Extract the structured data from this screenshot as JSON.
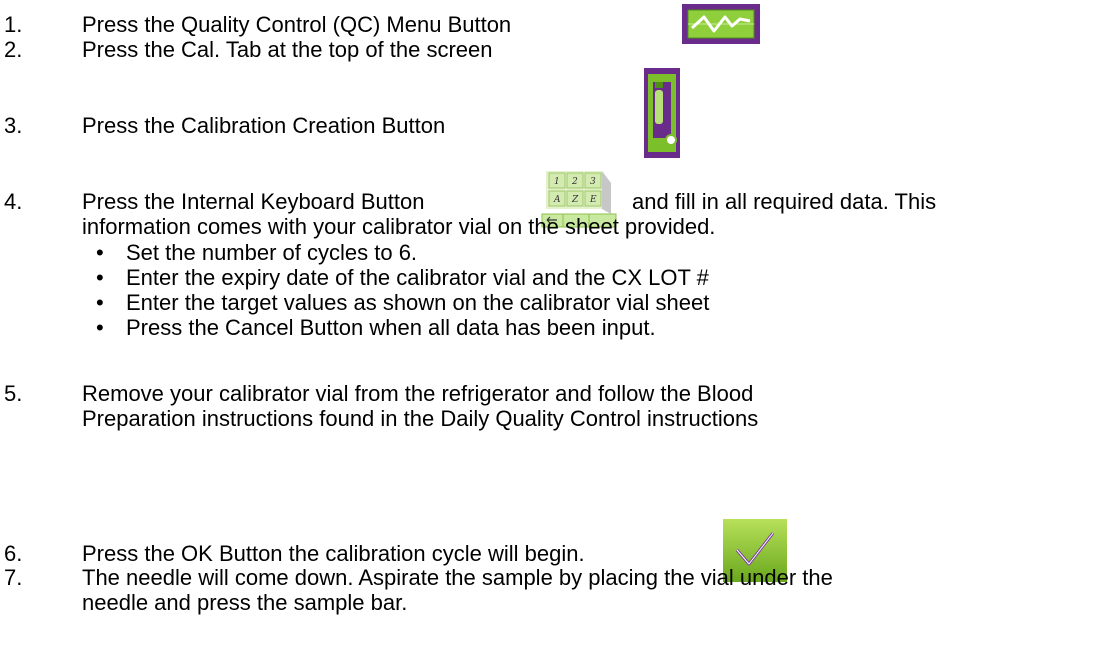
{
  "steps": [
    {
      "number": "1.",
      "text": "Press the Quality Control (QC) Menu Button"
    },
    {
      "number": "2.",
      "text": "Press the Cal. Tab at the top of the screen"
    },
    {
      "number": "3.",
      "text": "Press the Calibration Creation Button"
    },
    {
      "number": "4.",
      "text": "Press the Internal Keyboard Button",
      "text_after": "and fill in all required data. This",
      "text_cont": "information comes with your calibrator vial on the sheet provided."
    },
    {
      "number": "5.",
      "text": "Remove your calibrator vial from the refrigerator and follow the Blood",
      "text_cont": "Preparation instructions found in the Daily Quality Control instructions"
    },
    {
      "number": "6.",
      "text": "Press the OK Button the calibration cycle will begin."
    },
    {
      "number": "7.",
      "text": "The needle will come down. Aspirate the sample by placing the vial under the",
      "text_cont": "needle and press the sample bar."
    }
  ],
  "bullets": [
    "Set the number of cycles to 6.",
    "Enter the expiry date of the calibrator vial and the CX LOT #",
    "Enter the target values as shown on the calibrator vial sheet",
    "Press the Cancel Button when all data has been input."
  ],
  "bullet_char": "•",
  "keyboard_keys": [
    "1",
    "2",
    "3",
    "A",
    "Z",
    "E"
  ],
  "icons": {
    "qc_menu": "qc-waveform-icon",
    "calibration_creation": "calibration-creation-icon",
    "internal_keyboard": "keyboard-icon",
    "ok": "checkmark-icon"
  },
  "colors": {
    "purple": "#6a2c8a",
    "green": "#7bbf2a",
    "light_green": "#cfe8a8",
    "text": "#000000"
  }
}
